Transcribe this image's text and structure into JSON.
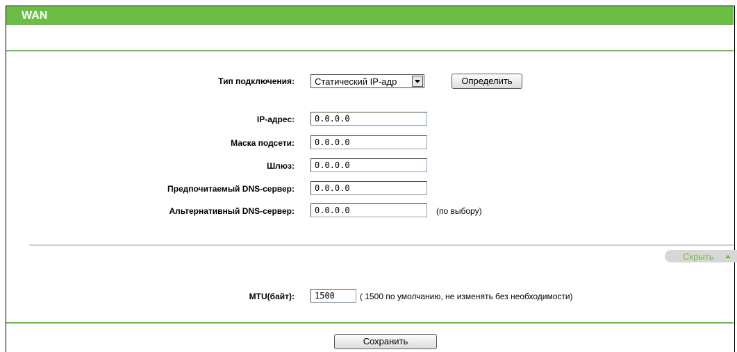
{
  "header": {
    "title": "WAN"
  },
  "colors": {
    "accent": "#6cbd45",
    "hide_tab_bg": "#d7d7d7"
  },
  "form": {
    "connection_type_label": "Тип подключения:",
    "connection_type_value": "Статический IP-адр",
    "detect_button": "Определить",
    "ip_label": "IP-адрес:",
    "ip_value": "0.0.0.0",
    "mask_label": "Маска подсети:",
    "mask_value": "0.0.0.0",
    "gateway_label": "Шлюз:",
    "gateway_value": "0.0.0.0",
    "dns1_label": "Предпочитаемый DNS-сервер:",
    "dns1_value": "0.0.0.0",
    "dns2_label": "Альтернативный DNS-сервер:",
    "dns2_value": "0.0.0.0",
    "dns2_note": "(по выбору)"
  },
  "advanced": {
    "toggle_label": "Скрыть",
    "mtu_label": "MTU(байт):",
    "mtu_value": "1500",
    "mtu_note": "( 1500 по умолчанию, не изменять без необходимости)"
  },
  "footer": {
    "save_button": "Сохранить"
  }
}
